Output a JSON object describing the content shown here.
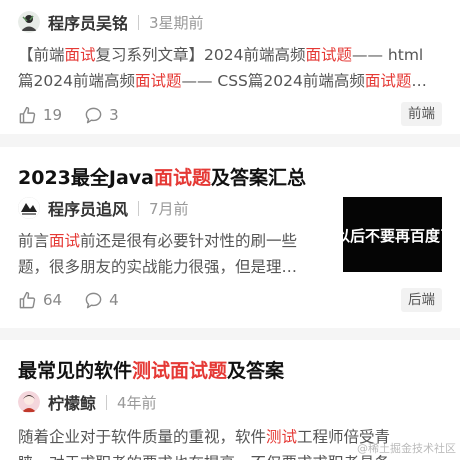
{
  "articles": [
    {
      "author": "程序员吴铭",
      "time": "3星期前",
      "excerpt_line1": [
        "【前端",
        "面试",
        "复习系列文章】2024前端高频",
        "面试题",
        "—— html"
      ],
      "excerpt_line2": [
        "篇2024前端高频",
        "面试题",
        "—— CSS篇2024前端高频",
        "面试题",
        "…"
      ],
      "likes": "19",
      "comments": "3",
      "tag": "前端"
    },
    {
      "title_parts": [
        "2023最全Java",
        "面试题",
        "及答案汇总"
      ],
      "author": "程序员追风",
      "time": "7月前",
      "excerpt_line1": [
        "前言",
        "面试",
        "前还是很有必要针对性的刷一些"
      ],
      "excerpt_line2": "题，很多朋友的实战能力很强，但是理…",
      "thumb_text": "以后不要再百度了",
      "likes": "64",
      "comments": "4",
      "tag": "后端"
    },
    {
      "title_parts": [
        "最常见的软件",
        "测试",
        "面试题",
        "及答案"
      ],
      "author": "柠檬鲸",
      "time": "4年前",
      "excerpt_line1": [
        "随着企业对于软件质量的重视，软件",
        "测试",
        "工程师倍受青"
      ],
      "excerpt_line2": "睐，对于求职者的要求也在提高，不仅要求求职者具备"
    }
  ],
  "watermark": "@稀土掘金技术社区",
  "colors": {
    "highlight": "#e53935",
    "background": "#f5f5f5"
  },
  "icons": [
    "like-icon",
    "comment-icon"
  ]
}
